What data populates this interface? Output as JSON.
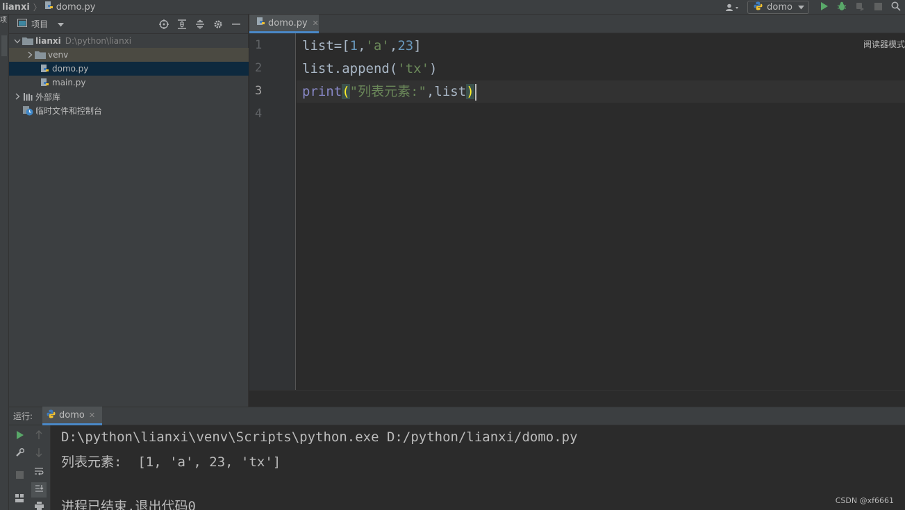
{
  "breadcrumb": {
    "root": "lianxi",
    "file": "domo.py"
  },
  "toolbar": {
    "run_config": "domo"
  },
  "left_strip": {
    "label": "项"
  },
  "project": {
    "title": "项目",
    "root": {
      "name": "lianxi",
      "path": "D:\\python\\lianxi"
    },
    "items": [
      {
        "label": "venv"
      },
      {
        "label": "domo.py"
      },
      {
        "label": "main.py"
      },
      {
        "label": "外部库"
      },
      {
        "label": "临时文件和控制台"
      }
    ]
  },
  "editor": {
    "tab_label": "domo.py",
    "reader_mode": "阅读器模式",
    "line_numbers": [
      "1",
      "2",
      "3",
      "4"
    ]
  },
  "run": {
    "label": "运行:",
    "tab_label": "domo",
    "console_lines": [
      "D:\\python\\lianxi\\venv\\Scripts\\python.exe D:/python/lianxi/domo.py",
      "列表元素:  [1, 'a', 23, 'tx']",
      "",
      "进程已结束,退出代码0"
    ]
  },
  "watermark": "CSDN @xf6661",
  "colors": {
    "accent": "#4a88c7",
    "run_green": "#59a869",
    "selection": "#0d293e"
  }
}
